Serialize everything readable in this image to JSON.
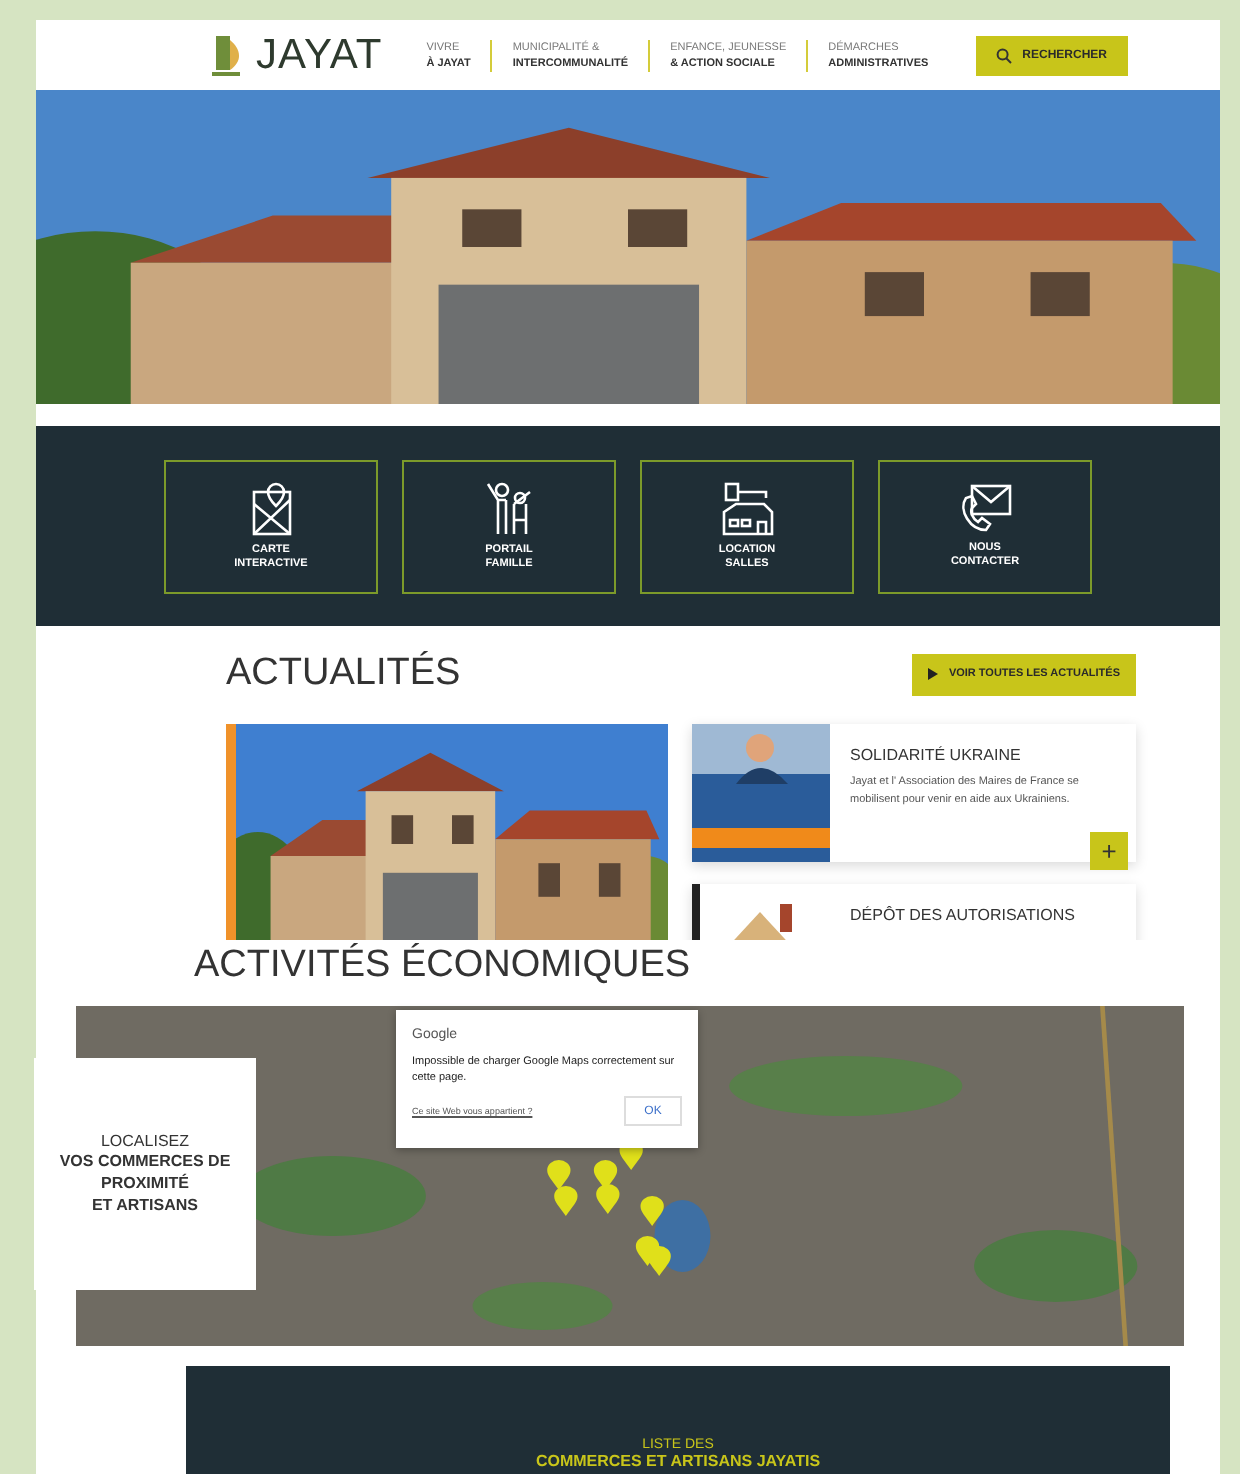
{
  "header": {
    "logo_text": "JAYAT",
    "search_button": "RECHERCHER",
    "nav": [
      {
        "line1": "VIVRE",
        "line2": "À JAYAT"
      },
      {
        "line1": "MUNICIPALITÉ &",
        "line2": "INTERCOMMUNALITÉ"
      },
      {
        "line1": "ENFANCE, JEUNESSE",
        "line2": "& ACTION SOCIALE"
      },
      {
        "line1": "DÉMARCHES",
        "line2": "ADMINISTRATIVES"
      }
    ]
  },
  "quick_links": [
    {
      "lines": [
        "CARTE",
        "INTERACTIVE"
      ]
    },
    {
      "lines": [
        "PORTAIL",
        "FAMILLE"
      ]
    },
    {
      "lines": [
        "LOCATION",
        "SALLES"
      ]
    },
    {
      "lines": [
        "NOUS",
        "CONTACTER"
      ]
    }
  ],
  "news": {
    "title": "ACTUALITÉS",
    "all_button": "VOIR TOUTES LES ACTUALITÉS",
    "items": [
      {
        "title": "SOLIDARITÉ UKRAINE",
        "summary": "Jayat et l' Association des Maires de France se mobilisent pour venir en aide aux Ukrainiens.",
        "more_button": "+"
      },
      {
        "title": "DÉPÔT DES AUTORISATIONS"
      }
    ]
  },
  "economy": {
    "title": "ACTIVITÉS ÉCONOMIQUES",
    "panel_intro": "LOCALISEZ",
    "panel_lines": [
      "VOS COMMERCES DE",
      "PROXIMITÉ",
      "ET ARTISANS"
    ],
    "map_error": {
      "brand": "Google",
      "message": "Impossible de charger Google Maps correctement sur cette page.",
      "link": "Ce site Web vous appartient ?",
      "button": "OK"
    }
  },
  "list_banner": {
    "line1": "LISTE DES",
    "line2": "COMMERCES ET ARTISANS JAYATIS"
  }
}
